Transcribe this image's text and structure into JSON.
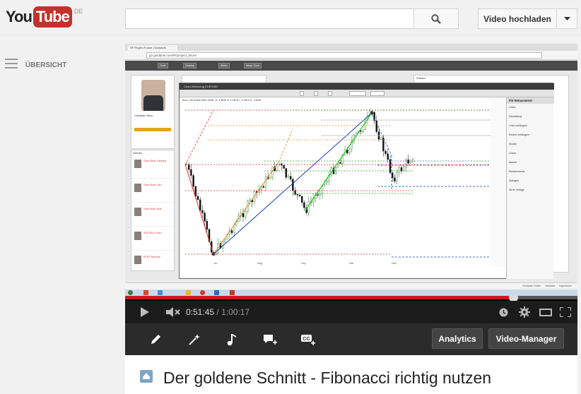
{
  "header": {
    "logo_you": "You",
    "logo_tube": "Tube",
    "country": "DE",
    "search_placeholder": "",
    "upload_label": "Video hochladen"
  },
  "guide": {
    "label": "ÜBERSICHT"
  },
  "browser": {
    "tab_label": "SP Project Future | Guidants",
    "url": "go.guidants.com/#r/project_future"
  },
  "app": {
    "nav_items": [
      "",
      "Chart",
      "Desktop",
      "Aktien",
      "Neuer Chart"
    ],
    "profile_name": "Christian Stern",
    "feed_title": "Stream",
    "right_title": "Stream",
    "stream_items": [
      "Gold Short: Einstieg",
      "Gold Short: Ziel",
      "Gold Short: Bull",
      "S&P 500 e-mini",
      "EPSX Reverse"
    ],
    "chart_window_title": "Chart-Werkzeug EUR/USD",
    "chart_info": "Euro / US-Dollar (Bid, USD): O: 1,3530 H: 1,3576 L: 1,3413 C: 1,3425",
    "fib_panel": {
      "title": "Fib Retracement",
      "labels": [
        "Linien",
        "Darstellung",
        "Links verlängern",
        "Rechts verlängern",
        "Modus",
        "Linear",
        "Marker",
        "Retracements",
        "Vorlagen",
        "Neue Vorlage"
      ]
    },
    "x_ticks": [
      "Jul",
      "Aug",
      "Sep",
      "Okt",
      "Nov"
    ],
    "footer_links": [
      "Guidants Trader",
      "Jaroslaw",
      "Impressum"
    ]
  },
  "player": {
    "current_time": "0:51:45",
    "total_time": "1:00:17",
    "progress": 0.858
  },
  "edit_bar": {
    "analytics_label": "Analytics",
    "manager_label": "Video-Manager"
  },
  "video": {
    "title": "Der goldene Schnitt - Fibonacci richtig nutzen"
  },
  "colors": {
    "youtube_red": "#c4302b",
    "progress_red": "#cc181e",
    "candle_up": "#1f7a1f",
    "candle_down": "#111111",
    "fib_red": "#e03030",
    "fib_green": "#2a9d2a",
    "fib_blue": "#1840c0",
    "fib_orange": "#e08a20"
  }
}
